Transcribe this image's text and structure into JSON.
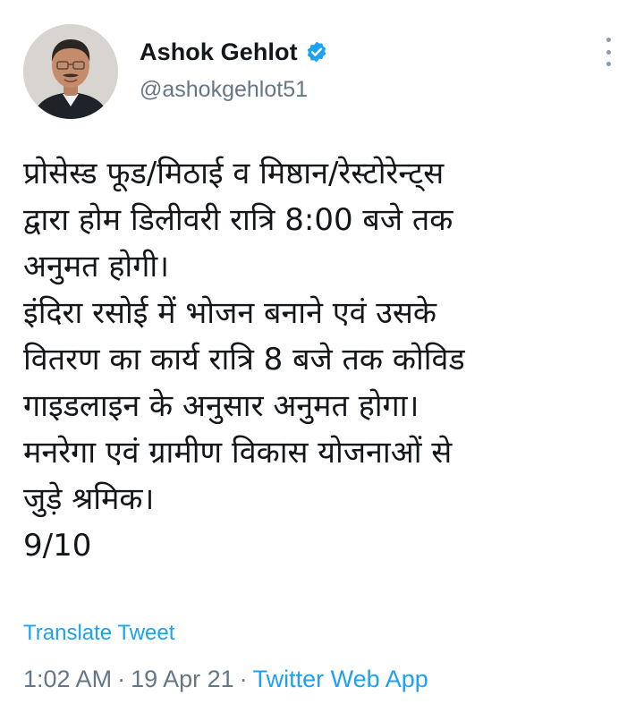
{
  "author": {
    "display_name": "Ashok Gehlot",
    "handle": "@ashokgehlot51",
    "verified_icon": "verified-badge-icon"
  },
  "menu": {
    "icon": "more-options-icon"
  },
  "tweet": {
    "lines": [
      "प्रोसेस्ड फूड/मिठाई व मिष्ठान/रेस्टोरेन्ट्स",
      "द्वारा होम डिलीवरी रात्रि 8:00 बजे तक",
      "अनुमत होगी।",
      "इंदिरा रसोई में भोजन बनाने एवं उसके",
      "वितरण का कार्य रात्रि 8 बजे तक कोविड",
      "गाइडलाइन के अनुसार अनुमत होगा।",
      "मनरेगा एवं ग्रामीण विकास योजनाओं से",
      "जुड़े श्रमिक।",
      "9/10"
    ],
    "translate_label": "Translate Tweet"
  },
  "meta": {
    "time": "1:02 AM",
    "date": "19 Apr 21",
    "separator": "·",
    "source": "Twitter Web App"
  },
  "colors": {
    "accent": "#1da1f2",
    "secondary_text": "#657786",
    "primary_text": "#14171a"
  }
}
